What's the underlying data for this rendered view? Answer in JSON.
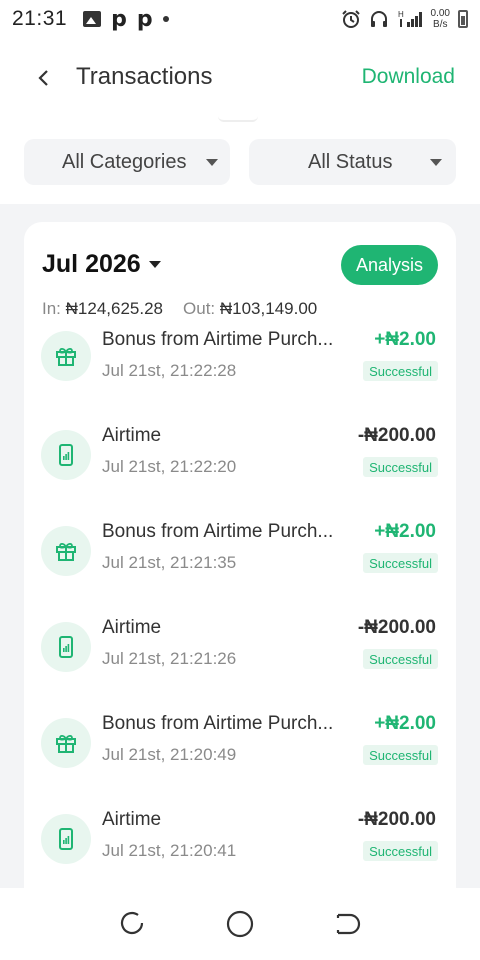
{
  "statusbar": {
    "time": "21:31",
    "p1": "p",
    "p2": "p",
    "net_speed": "0.00",
    "net_unit": "B/s",
    "signal_label": "H"
  },
  "header": {
    "title": "Transactions",
    "download_label": "Download"
  },
  "filters": {
    "category": "All Categories",
    "status": "All Status"
  },
  "summary": {
    "month": "Jul 2026",
    "analysis_label": "Analysis",
    "in_label": "In:",
    "in_value": "₦124,625.28",
    "out_label": "Out:",
    "out_value": "₦103,149.00"
  },
  "transactions": [
    {
      "type": "bonus",
      "name": "Bonus from Airtime Purch...",
      "date": "Jul 21st, 21:22:28",
      "amount": "+₦2.00",
      "status": "Successful",
      "icon": "gift-icon"
    },
    {
      "type": "airtime",
      "name": "Airtime",
      "date": "Jul 21st, 21:22:20",
      "amount": "-₦200.00",
      "status": "Successful",
      "icon": "phone-icon"
    },
    {
      "type": "bonus",
      "name": "Bonus from Airtime Purch...",
      "date": "Jul 21st, 21:21:35",
      "amount": "+₦2.00",
      "status": "Successful",
      "icon": "gift-icon"
    },
    {
      "type": "airtime",
      "name": "Airtime",
      "date": "Jul 21st, 21:21:26",
      "amount": "-₦200.00",
      "status": "Successful",
      "icon": "phone-icon"
    },
    {
      "type": "bonus",
      "name": "Bonus from Airtime Purch...",
      "date": "Jul 21st, 21:20:49",
      "amount": "+₦2.00",
      "status": "Successful",
      "icon": "gift-icon"
    },
    {
      "type": "airtime",
      "name": "Airtime",
      "date": "Jul 21st, 21:20:41",
      "amount": "-₦200.00",
      "status": "Successful",
      "icon": "phone-icon"
    }
  ],
  "colors": {
    "accent": "#1fb573",
    "accent_light": "#e8f6ef",
    "background_grey": "#f3f4f6"
  },
  "navbar": {
    "buttons": [
      "recents-icon",
      "home-icon",
      "back-nav-icon"
    ]
  }
}
